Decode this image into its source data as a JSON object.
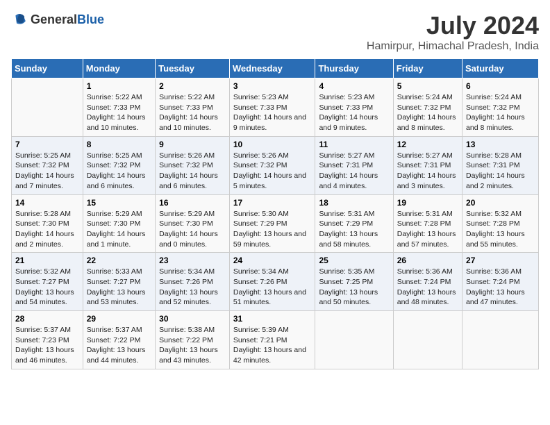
{
  "header": {
    "logo_general": "General",
    "logo_blue": "Blue",
    "title": "July 2024",
    "subtitle": "Hamirpur, Himachal Pradesh, India"
  },
  "calendar": {
    "weekdays": [
      "Sunday",
      "Monday",
      "Tuesday",
      "Wednesday",
      "Thursday",
      "Friday",
      "Saturday"
    ],
    "rows": [
      [
        {
          "day": "",
          "info": ""
        },
        {
          "day": "1",
          "info": "Sunrise: 5:22 AM\nSunset: 7:33 PM\nDaylight: 14 hours\nand 10 minutes."
        },
        {
          "day": "2",
          "info": "Sunrise: 5:22 AM\nSunset: 7:33 PM\nDaylight: 14 hours\nand 10 minutes."
        },
        {
          "day": "3",
          "info": "Sunrise: 5:23 AM\nSunset: 7:33 PM\nDaylight: 14 hours\nand 9 minutes."
        },
        {
          "day": "4",
          "info": "Sunrise: 5:23 AM\nSunset: 7:33 PM\nDaylight: 14 hours\nand 9 minutes."
        },
        {
          "day": "5",
          "info": "Sunrise: 5:24 AM\nSunset: 7:32 PM\nDaylight: 14 hours\nand 8 minutes."
        },
        {
          "day": "6",
          "info": "Sunrise: 5:24 AM\nSunset: 7:32 PM\nDaylight: 14 hours\nand 8 minutes."
        }
      ],
      [
        {
          "day": "7",
          "info": "Sunrise: 5:25 AM\nSunset: 7:32 PM\nDaylight: 14 hours\nand 7 minutes."
        },
        {
          "day": "8",
          "info": "Sunrise: 5:25 AM\nSunset: 7:32 PM\nDaylight: 14 hours\nand 6 minutes."
        },
        {
          "day": "9",
          "info": "Sunrise: 5:26 AM\nSunset: 7:32 PM\nDaylight: 14 hours\nand 6 minutes."
        },
        {
          "day": "10",
          "info": "Sunrise: 5:26 AM\nSunset: 7:32 PM\nDaylight: 14 hours\nand 5 minutes."
        },
        {
          "day": "11",
          "info": "Sunrise: 5:27 AM\nSunset: 7:31 PM\nDaylight: 14 hours\nand 4 minutes."
        },
        {
          "day": "12",
          "info": "Sunrise: 5:27 AM\nSunset: 7:31 PM\nDaylight: 14 hours\nand 3 minutes."
        },
        {
          "day": "13",
          "info": "Sunrise: 5:28 AM\nSunset: 7:31 PM\nDaylight: 14 hours\nand 2 minutes."
        }
      ],
      [
        {
          "day": "14",
          "info": "Sunrise: 5:28 AM\nSunset: 7:30 PM\nDaylight: 14 hours\nand 2 minutes."
        },
        {
          "day": "15",
          "info": "Sunrise: 5:29 AM\nSunset: 7:30 PM\nDaylight: 14 hours\nand 1 minute."
        },
        {
          "day": "16",
          "info": "Sunrise: 5:29 AM\nSunset: 7:30 PM\nDaylight: 14 hours\nand 0 minutes."
        },
        {
          "day": "17",
          "info": "Sunrise: 5:30 AM\nSunset: 7:29 PM\nDaylight: 13 hours\nand 59 minutes."
        },
        {
          "day": "18",
          "info": "Sunrise: 5:31 AM\nSunset: 7:29 PM\nDaylight: 13 hours\nand 58 minutes."
        },
        {
          "day": "19",
          "info": "Sunrise: 5:31 AM\nSunset: 7:28 PM\nDaylight: 13 hours\nand 57 minutes."
        },
        {
          "day": "20",
          "info": "Sunrise: 5:32 AM\nSunset: 7:28 PM\nDaylight: 13 hours\nand 55 minutes."
        }
      ],
      [
        {
          "day": "21",
          "info": "Sunrise: 5:32 AM\nSunset: 7:27 PM\nDaylight: 13 hours\nand 54 minutes."
        },
        {
          "day": "22",
          "info": "Sunrise: 5:33 AM\nSunset: 7:27 PM\nDaylight: 13 hours\nand 53 minutes."
        },
        {
          "day": "23",
          "info": "Sunrise: 5:34 AM\nSunset: 7:26 PM\nDaylight: 13 hours\nand 52 minutes."
        },
        {
          "day": "24",
          "info": "Sunrise: 5:34 AM\nSunset: 7:26 PM\nDaylight: 13 hours\nand 51 minutes."
        },
        {
          "day": "25",
          "info": "Sunrise: 5:35 AM\nSunset: 7:25 PM\nDaylight: 13 hours\nand 50 minutes."
        },
        {
          "day": "26",
          "info": "Sunrise: 5:36 AM\nSunset: 7:24 PM\nDaylight: 13 hours\nand 48 minutes."
        },
        {
          "day": "27",
          "info": "Sunrise: 5:36 AM\nSunset: 7:24 PM\nDaylight: 13 hours\nand 47 minutes."
        }
      ],
      [
        {
          "day": "28",
          "info": "Sunrise: 5:37 AM\nSunset: 7:23 PM\nDaylight: 13 hours\nand 46 minutes."
        },
        {
          "day": "29",
          "info": "Sunrise: 5:37 AM\nSunset: 7:22 PM\nDaylight: 13 hours\nand 44 minutes."
        },
        {
          "day": "30",
          "info": "Sunrise: 5:38 AM\nSunset: 7:22 PM\nDaylight: 13 hours\nand 43 minutes."
        },
        {
          "day": "31",
          "info": "Sunrise: 5:39 AM\nSunset: 7:21 PM\nDaylight: 13 hours\nand 42 minutes."
        },
        {
          "day": "",
          "info": ""
        },
        {
          "day": "",
          "info": ""
        },
        {
          "day": "",
          "info": ""
        }
      ]
    ]
  }
}
